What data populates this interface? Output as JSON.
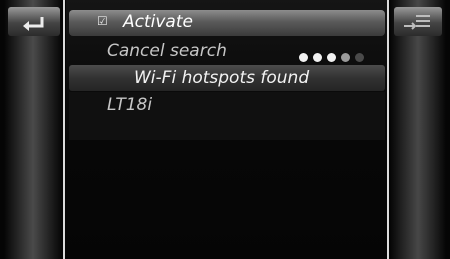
{
  "menu": {
    "activate_label": "Activate",
    "activate_check": "☑",
    "cancel_label": "Cancel search",
    "found_heading": "Wi-Fi hotspots found",
    "networks": [
      "LT18i"
    ]
  },
  "icons": {
    "back": "back-arrow-icon",
    "options": "list-options-icon"
  },
  "search_progress_dots": [
    {
      "state": "active"
    },
    {
      "state": "active"
    },
    {
      "state": "active"
    },
    {
      "state": "dim"
    },
    {
      "state": "dim"
    }
  ],
  "colors": {
    "screen_bg": "#050505",
    "divider": "#dcdcdc",
    "text_primary": "#ffffff",
    "text_secondary": "#c6c6c6",
    "dot_active": "#f2f2f2",
    "dot_mid": "#9a9a9a",
    "dot_dim": "#4a4a4a"
  }
}
